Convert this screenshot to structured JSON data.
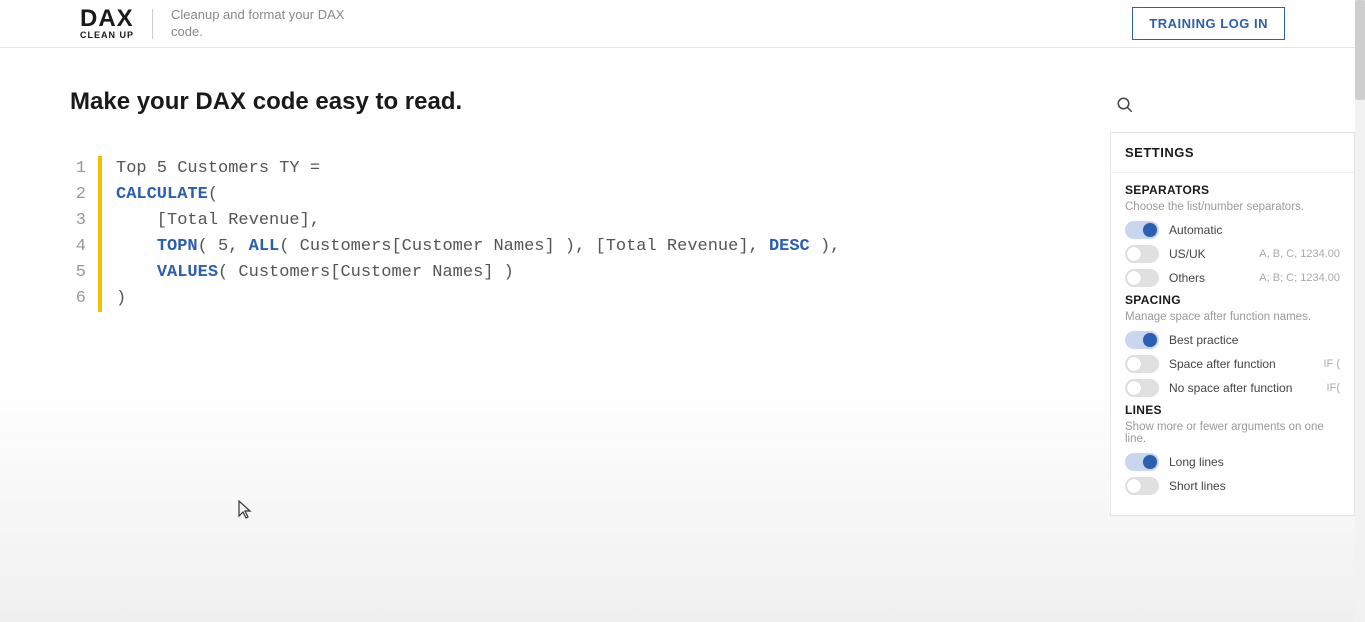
{
  "header": {
    "logo_main": "DAX",
    "logo_sub": "CLEAN UP",
    "tagline": "Cleanup and format your DAX code.",
    "training_login": "TRAINING LOG IN"
  },
  "page": {
    "title": "Make your DAX code easy to read."
  },
  "code": {
    "line_numbers": [
      "1",
      "2",
      "3",
      "4",
      "5",
      "6"
    ],
    "lines": [
      [
        {
          "t": "Top 5 Customers TY =",
          "c": "plain"
        }
      ],
      [
        {
          "t": "CALCULATE",
          "c": "func"
        },
        {
          "t": "(",
          "c": "plain"
        }
      ],
      [
        {
          "t": "    [Total Revenue],",
          "c": "plain"
        }
      ],
      [
        {
          "t": "    ",
          "c": "plain"
        },
        {
          "t": "TOPN",
          "c": "func"
        },
        {
          "t": "( 5, ",
          "c": "plain"
        },
        {
          "t": "ALL",
          "c": "func"
        },
        {
          "t": "( Customers[Customer Names] ), [Total Revenue], ",
          "c": "plain"
        },
        {
          "t": "DESC",
          "c": "key"
        },
        {
          "t": " ),",
          "c": "plain"
        }
      ],
      [
        {
          "t": "    ",
          "c": "plain"
        },
        {
          "t": "VALUES",
          "c": "func"
        },
        {
          "t": "( Customers[Customer Names] )",
          "c": "plain"
        }
      ],
      [
        {
          "t": ")",
          "c": "plain"
        }
      ]
    ]
  },
  "settings": {
    "header": "SETTINGS",
    "sections": {
      "separators": {
        "title": "SEPARATORS",
        "desc": "Choose the list/number separators.",
        "options": [
          {
            "label": "Automatic",
            "on": true,
            "hint": ""
          },
          {
            "label": "US/UK",
            "on": false,
            "hint": "A, B, C, 1234.00"
          },
          {
            "label": "Others",
            "on": false,
            "hint": "A; B; C; 1234.00"
          }
        ]
      },
      "spacing": {
        "title": "SPACING",
        "desc": "Manage space after function names.",
        "options": [
          {
            "label": "Best practice",
            "on": true,
            "hint": ""
          },
          {
            "label": "Space after function",
            "on": false,
            "hint": "IF ("
          },
          {
            "label": "No space after function",
            "on": false,
            "hint": "IF("
          }
        ]
      },
      "lines": {
        "title": "LINES",
        "desc": "Show more or fewer arguments on one line.",
        "options": [
          {
            "label": "Long lines",
            "on": true,
            "hint": ""
          },
          {
            "label": "Short lines",
            "on": false,
            "hint": ""
          }
        ]
      }
    }
  }
}
